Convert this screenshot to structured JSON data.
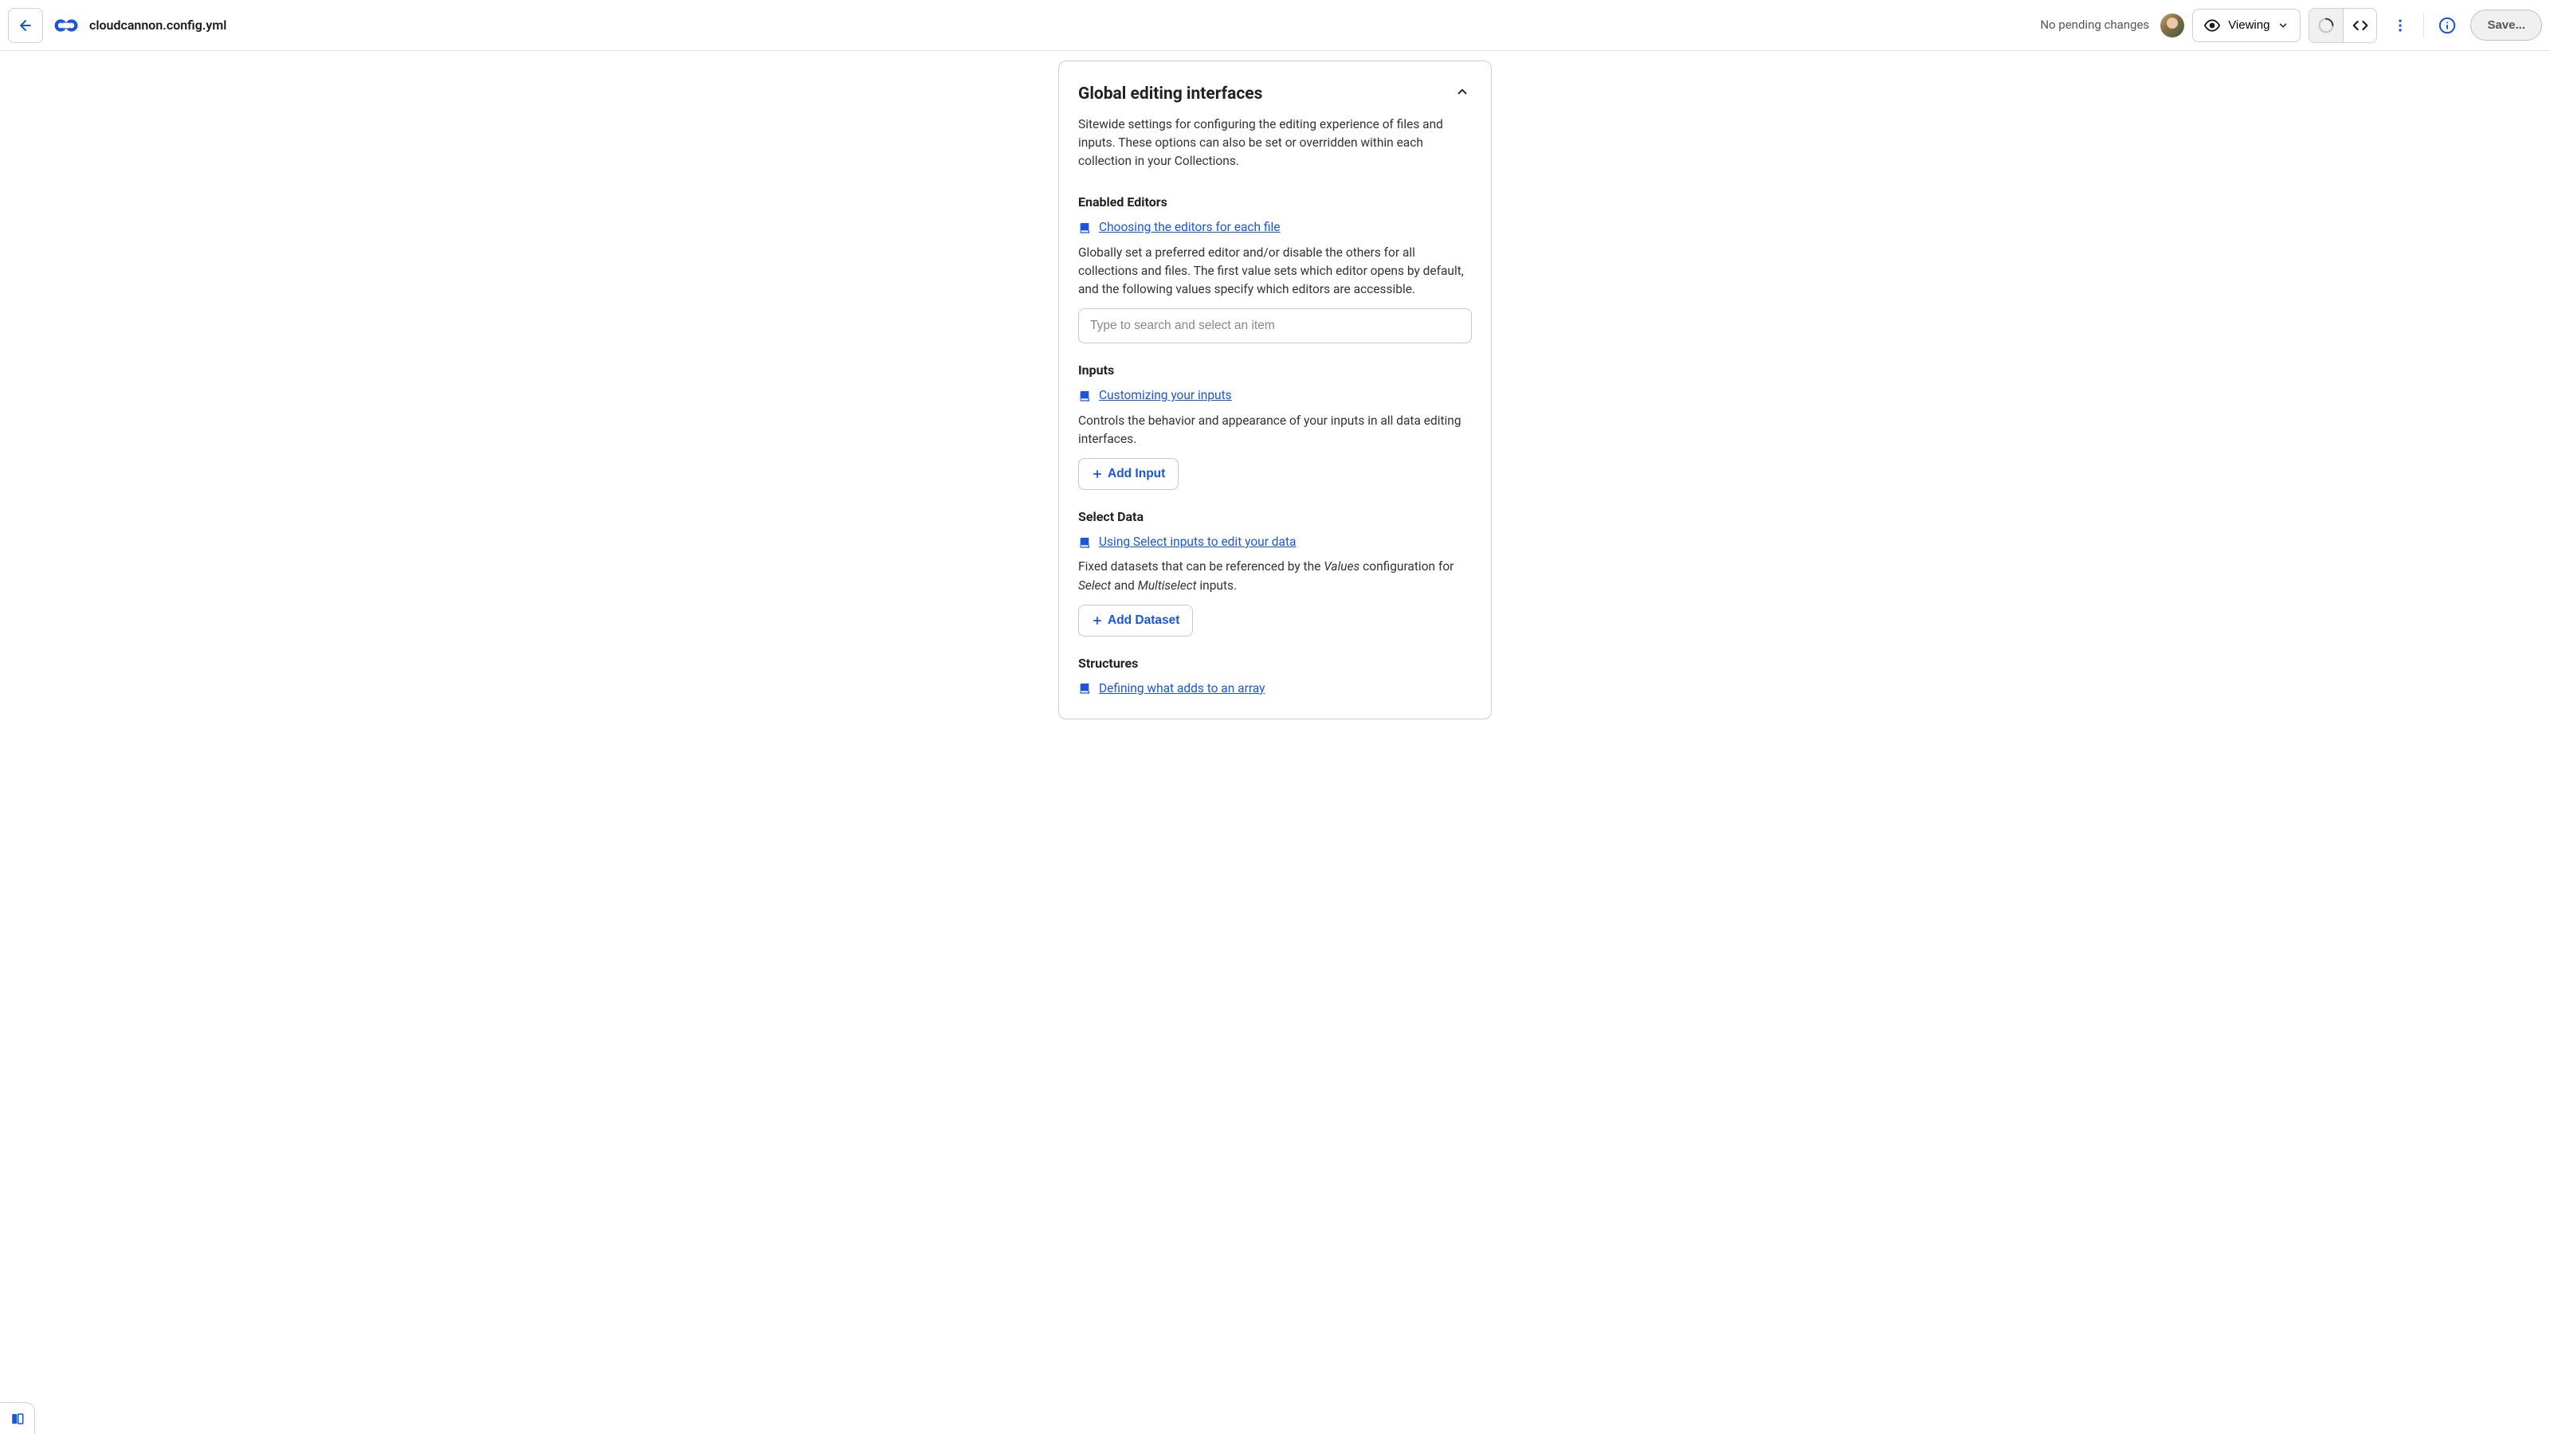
{
  "header": {
    "filename": "cloudcannon.config.yml",
    "pending": "No pending changes",
    "viewing_label": "Viewing",
    "save_label": "Save..."
  },
  "card": {
    "title": "Global editing interfaces",
    "description": "Sitewide settings for configuring the editing experience of files and inputs. These options can also be set or overridden within each collection in your Collections."
  },
  "sections": {
    "enabled_editors": {
      "title": "Enabled Editors",
      "doc_link": "Choosing the editors for each file",
      "description": "Globally set a preferred editor and/or disable the others for all collections and files. The first value sets which editor opens by default, and the following values specify which editors are accessible.",
      "placeholder": "Type to search and select an item"
    },
    "inputs": {
      "title": "Inputs",
      "doc_link": "Customizing your inputs",
      "description": "Controls the behavior and appearance of your inputs in all data editing interfaces.",
      "button": "Add Input"
    },
    "select_data": {
      "title": "Select Data",
      "doc_link": "Using Select inputs to edit your data",
      "desc_pre": "Fixed datasets that can be referenced by the ",
      "desc_em1": "Values",
      "desc_mid": " configuration for ",
      "desc_em2": "Select",
      "desc_and": " and ",
      "desc_em3": "Multiselect",
      "desc_post": " inputs.",
      "button": "Add Dataset"
    },
    "structures": {
      "title": "Structures",
      "doc_link": "Defining what adds to an array"
    }
  }
}
